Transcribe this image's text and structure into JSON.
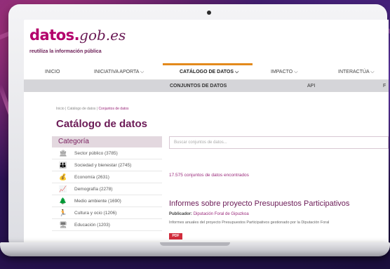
{
  "site": {
    "logo_main": "datos.",
    "logo_domain": "gob.es",
    "tagline": "reutiliza la información pública"
  },
  "nav": {
    "items": [
      {
        "label": "INICIO"
      },
      {
        "label": "INICIATIVA APORTA ⌵"
      },
      {
        "label": "CATÁLOGO DE DATOS ⌵"
      },
      {
        "label": "IMPACTO ⌵"
      },
      {
        "label": "INTERACTÚA ⌵"
      }
    ],
    "active_index": 2
  },
  "subnav": {
    "items": [
      {
        "label": "CONJUNTOS DE DATOS"
      },
      {
        "label": "API"
      },
      {
        "label": "F"
      }
    ]
  },
  "breadcrumb": {
    "home": "Inicio",
    "sep1": " | ",
    "catalog": "Catálogo de datos",
    "sep2": " | ",
    "current": "Conjuntos de datos"
  },
  "page_title": "Catálogo de datos",
  "sidebar": {
    "heading": "Categoría",
    "items": [
      {
        "icon": "building-icon",
        "glyph": "🏛",
        "label": "Sector público (3785)"
      },
      {
        "icon": "people-icon",
        "glyph": "👪",
        "label": "Sociedad y bienestar (2745)"
      },
      {
        "icon": "money-icon",
        "glyph": "💰",
        "label": "Economía (2631)"
      },
      {
        "icon": "chart-icon",
        "glyph": "📈",
        "label": "Demografía (2278)"
      },
      {
        "icon": "tree-icon",
        "glyph": "🌲",
        "label": "Medio ambiente (1690)"
      },
      {
        "icon": "runner-icon",
        "glyph": "🏃",
        "label": "Cultura y ocio (1206)"
      },
      {
        "icon": "screen-icon",
        "glyph": "🖥",
        "label": "Educación (1203)"
      }
    ]
  },
  "search": {
    "placeholder": "Buscar conjuntos de datos..."
  },
  "results": {
    "count_text": "17.575 conjuntos de datos encontrados",
    "first": {
      "title": "Informes sobre proyecto Presupuestos Participativos",
      "publisher_label": "Publicador:",
      "publisher": "Diputación Foral de Gipuzkoa",
      "description": "Informes anuales del proyecto Presupuestos Participativos gestionado por la Diputación Foral",
      "format": "PDF"
    }
  },
  "colors": {
    "brand": "#b3006b",
    "accent": "#e38a1c",
    "pdf_badge": "#d12c3c"
  }
}
